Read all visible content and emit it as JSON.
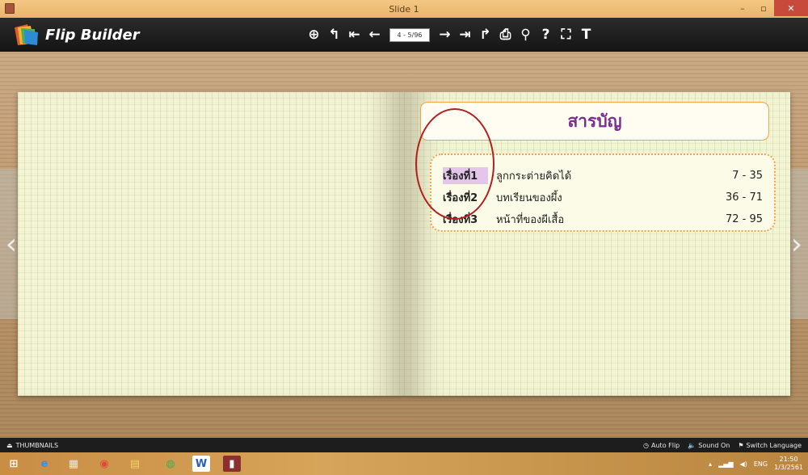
{
  "window": {
    "title": "Slide 1",
    "minimize_label": "–",
    "maximize_label": "▫",
    "close_label": "✕"
  },
  "toolbar": {
    "app_name": "Flip Builder",
    "page_indicator": "4 - 5/96",
    "tool_glyphs": {
      "zoom_in": "⊕",
      "back": "↰",
      "first": "⇤",
      "prev": "←",
      "next": "→",
      "last": "⇥",
      "forward": "↱",
      "print": "⎙",
      "search": "⚲",
      "help": "?",
      "fullscreen": "⛶",
      "text": "T"
    }
  },
  "toc": {
    "heading": "สารบัญ",
    "items": [
      {
        "chapter": "เรื่องที่1",
        "title": "ลูกกระต่ายคิดได้",
        "pages": "7 - 35"
      },
      {
        "chapter": "เรื่องที่2",
        "title": "บทเรียนของผึ้ง",
        "pages": "36 - 71"
      },
      {
        "chapter": "เรื่องที่3",
        "title": "หน้าที่ของผีเสื้อ",
        "pages": "72 - 95"
      }
    ]
  },
  "bottombar": {
    "thumbnails_label": "THUMBNAILS",
    "auto_flip_label": "Auto Flip",
    "sound_label": "Sound On",
    "switch_language_label": "Switch Language"
  },
  "taskbar": {
    "language": "ENG",
    "time": "21:50",
    "date": "1/3/2561"
  },
  "colors": {
    "toolbar_bg": "#1a1a1a",
    "toc_heading": "#7a2d8e",
    "toc_border": "#f3a24c",
    "annotation_circle": "#b21f1f",
    "highlight": "#e3c6ea"
  }
}
